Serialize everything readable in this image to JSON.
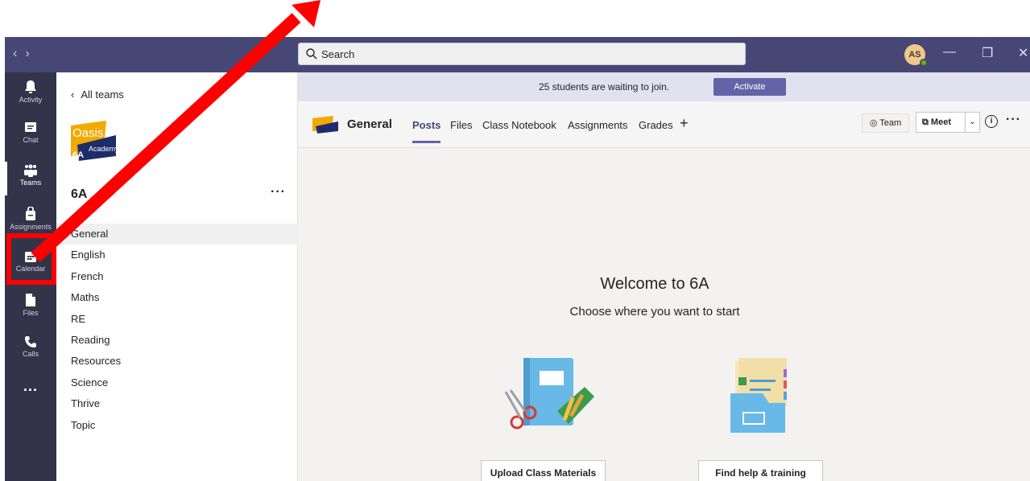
{
  "titlebar": {
    "search_placeholder": "Search",
    "avatar_initials": "AS",
    "minimize_glyph": "—",
    "maximize_glyph": "❐",
    "close_glyph": "✕"
  },
  "rail": {
    "items": [
      {
        "label": "Activity",
        "icon": "bell-icon"
      },
      {
        "label": "Chat",
        "icon": "chat-icon"
      },
      {
        "label": "Teams",
        "icon": "teams-icon"
      },
      {
        "label": "Assignments",
        "icon": "assignments-icon"
      },
      {
        "label": "Calendar",
        "icon": "calendar-icon"
      },
      {
        "label": "Files",
        "icon": "files-icon"
      },
      {
        "label": "Calls",
        "icon": "phone-icon"
      },
      {
        "label": "...",
        "icon": "more-icon"
      }
    ],
    "active_label": "Teams"
  },
  "sidebar": {
    "back_label": "All teams",
    "team_logo_text": "Oasis",
    "team_logo_subtext": "Academy",
    "team_logo_code": "6A",
    "team_name": "6A",
    "team_more": "···",
    "channels": [
      "General",
      "English",
      "French",
      "Maths",
      "RE",
      "Reading",
      "Resources",
      "Science",
      "Thrive",
      "Topic"
    ],
    "active_channel": "General"
  },
  "banner": {
    "message": "25 students are waiting to join.",
    "action_label": "Activate"
  },
  "channel_header": {
    "name": "General",
    "tabs": [
      "Posts",
      "Files",
      "Class Notebook",
      "Assignments",
      "Grades"
    ],
    "active_tab": "Posts",
    "add_tab": "+",
    "team_button": "Team",
    "meet_button": "Meet",
    "info_glyph": "i",
    "more_glyph": "···"
  },
  "welcome": {
    "title": "Welcome to 6A",
    "subtitle": "Choose where you want to start",
    "upload_button": "Upload Class Materials",
    "help_button": "Find help & training"
  },
  "colors": {
    "titlebar": "#464775",
    "rail": "#33344a",
    "accent": "#6264a7",
    "annotation": "#ff0000"
  }
}
